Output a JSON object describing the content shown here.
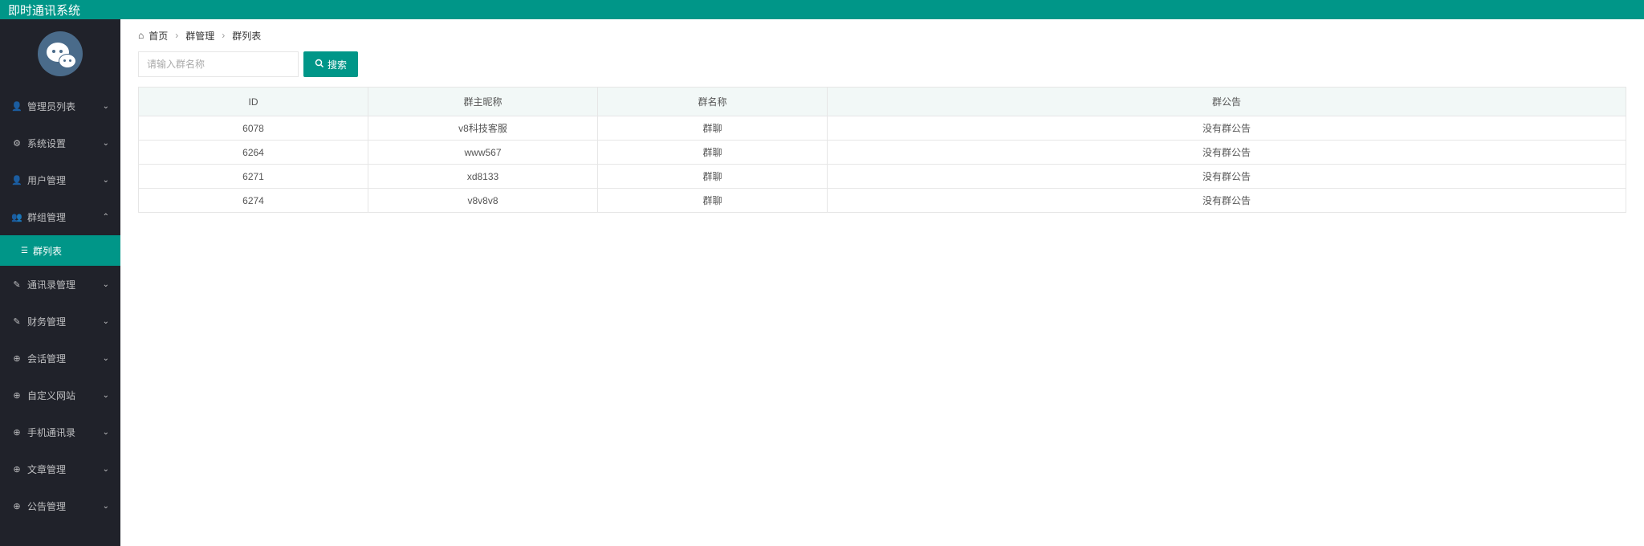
{
  "topbar": {
    "title": "即时通讯系统"
  },
  "sidebar": {
    "items": [
      {
        "icon": "user",
        "label": "管理员列表",
        "expanded": false
      },
      {
        "icon": "gear",
        "label": "系统设置",
        "expanded": false
      },
      {
        "icon": "user",
        "label": "用户管理",
        "expanded": false
      },
      {
        "icon": "users",
        "label": "群组管理",
        "expanded": true,
        "children": [
          {
            "icon": "list",
            "label": "群列表",
            "active": true
          }
        ]
      },
      {
        "icon": "edit",
        "label": "通讯录管理",
        "expanded": false
      },
      {
        "icon": "edit",
        "label": "财务管理",
        "expanded": false
      },
      {
        "icon": "globe",
        "label": "会话管理",
        "expanded": false
      },
      {
        "icon": "globe",
        "label": "自定义网站",
        "expanded": false
      },
      {
        "icon": "globe",
        "label": "手机通讯录",
        "expanded": false
      },
      {
        "icon": "globe",
        "label": "文章管理",
        "expanded": false
      },
      {
        "icon": "globe",
        "label": "公告管理",
        "expanded": false
      }
    ]
  },
  "breadcrumb": {
    "home": "首页",
    "level1": "群管理",
    "level2": "群列表"
  },
  "search": {
    "placeholder": "请输入群名称",
    "button_label": "搜索"
  },
  "table": {
    "headers": {
      "id": "ID",
      "owner": "群主昵称",
      "name": "群名称",
      "notice": "群公告"
    },
    "rows": [
      {
        "id": "6078",
        "owner": "v8科技客服",
        "name": "群聊",
        "notice": "没有群公告"
      },
      {
        "id": "6264",
        "owner": "www567",
        "name": "群聊",
        "notice": "没有群公告"
      },
      {
        "id": "6271",
        "owner": "xd8133",
        "name": "群聊",
        "notice": "没有群公告"
      },
      {
        "id": "6274",
        "owner": "v8v8v8",
        "name": "群聊",
        "notice": "没有群公告"
      }
    ]
  }
}
